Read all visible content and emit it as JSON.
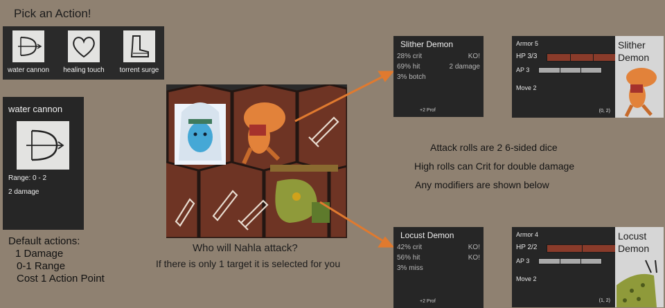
{
  "title": "Pick an Action!",
  "actions": [
    {
      "label": "water cannon",
      "icon": "bow-icon"
    },
    {
      "label": "healing touch",
      "icon": "heart-icon"
    },
    {
      "label": "torrent surge",
      "icon": "boot-icon"
    }
  ],
  "selected_action": {
    "name": "water cannon",
    "icon": "bow-icon",
    "range": "Range: 0 - 2",
    "damage": "2 damage"
  },
  "defaults": {
    "heading": "Default actions:",
    "damage": "1 Damage",
    "range": "0-1 Range",
    "cost": "Cost 1 Action Point"
  },
  "prompt": {
    "question": "Who will Nahla attack?",
    "note": "If there is only 1 target it is selected for you"
  },
  "info_lines": [
    "Attack rolls are 2 6-sided dice",
    "High rolls can Crit for double damage",
    "Any modifiers are shown below"
  ],
  "targets": [
    {
      "name": "Slither Demon",
      "rows": [
        {
          "left": "28% crit",
          "right": "KO!"
        },
        {
          "left": "69% hit",
          "right": "2 damage"
        },
        {
          "left": "3% botch",
          "right": ""
        }
      ],
      "prof": "+2 Prof",
      "armor": "Armor 5",
      "hp": "HP 3/3",
      "hp_fraction": 1.0,
      "ap": "AP 3",
      "ap_fraction": 1.0,
      "move": "Move 2",
      "coords": "(0, 2)",
      "portrait_name_1": "Slither",
      "portrait_name_2": "Demon"
    },
    {
      "name": "Locust Demon",
      "rows": [
        {
          "left": "42% crit",
          "right": "KO!"
        },
        {
          "left": "56% hit",
          "right": "KO!"
        },
        {
          "left": "3% miss",
          "right": ""
        }
      ],
      "prof": "+2 Prof",
      "armor": "Armor 4",
      "hp": "HP 2/2",
      "hp_fraction": 1.0,
      "ap": "AP 3",
      "ap_fraction": 1.0,
      "move": "Move 2",
      "coords": "(1, 2)",
      "portrait_name_1": "Locust",
      "portrait_name_2": "Demon"
    }
  ],
  "colors": {
    "background": "#8f8171",
    "panel": "#262626",
    "hex_tile": "#6e3424",
    "arrow": "#e07a2f",
    "hp_bar": "#8a3b2a",
    "ap_bar": "#a9a9a9"
  }
}
